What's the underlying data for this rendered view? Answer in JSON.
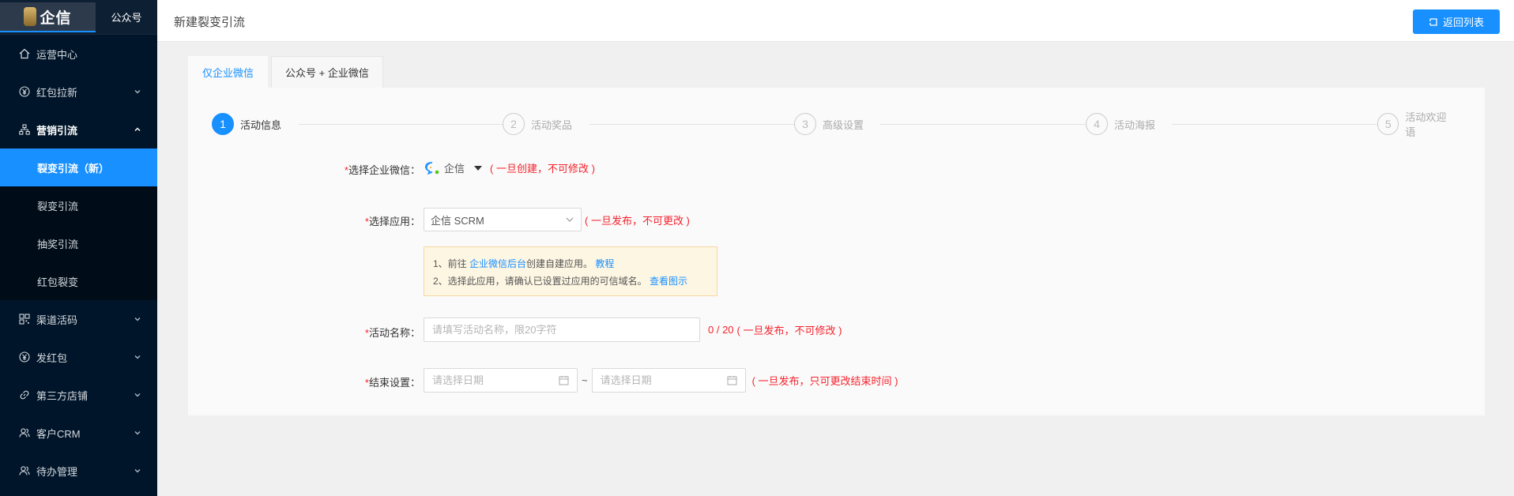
{
  "sidebar": {
    "logo_text": "企信",
    "account_tab": "公众号",
    "menu": [
      {
        "label": "运营中心",
        "icon": "home-icon"
      },
      {
        "label": "红包拉新",
        "icon": "yen-circle-icon"
      },
      {
        "label": "营销引流",
        "icon": "sitemap-icon"
      }
    ],
    "submenu": [
      {
        "label": "裂变引流（新）"
      },
      {
        "label": "裂变引流"
      },
      {
        "label": "抽奖引流"
      },
      {
        "label": "红包裂变"
      }
    ],
    "menu_after": [
      {
        "label": "渠道活码",
        "icon": "qrcode-icon"
      },
      {
        "label": "发红包",
        "icon": "yen-circle-icon"
      },
      {
        "label": "第三方店铺",
        "icon": "link-icon"
      },
      {
        "label": "客户CRM",
        "icon": "users-icon"
      },
      {
        "label": "待办管理",
        "icon": "users-icon"
      }
    ]
  },
  "header": {
    "title": "新建裂变引流",
    "back_label": "返回列表"
  },
  "tabs": [
    {
      "label": "仅企业微信",
      "active": true
    },
    {
      "label": "公众号 + 企业微信",
      "active": false
    }
  ],
  "steps": [
    {
      "num": "1",
      "label": "活动信息"
    },
    {
      "num": "2",
      "label": "活动奖品"
    },
    {
      "num": "3",
      "label": "高级设置"
    },
    {
      "num": "4",
      "label": "活动海报"
    },
    {
      "num": "5",
      "label": "活动欢迎语"
    }
  ],
  "form": {
    "corp_wechat": {
      "label": "选择企业微信：",
      "value": "企信",
      "hint": "( 一旦创建，不可修改 )"
    },
    "app": {
      "label": "选择应用：",
      "value": "企信 SCRM",
      "hint": "( 一旦发布，不可更改 )"
    },
    "notice": {
      "line1_prefix": "1、前往",
      "line1_link": "企业微信后台",
      "line1_suffix": "创建自建应用。",
      "line1_link2": "教程",
      "line2_text": "2、选择此应用，请确认已设置过应用的可信域名。",
      "line2_link": "查看图示"
    },
    "name": {
      "label": "活动名称：",
      "placeholder": "请填写活动名称，限20字符",
      "counter": "0 / 20",
      "hint": "( 一旦发布，不可修改 )"
    },
    "end": {
      "label": "结束设置：",
      "start_placeholder": "请选择日期",
      "separator": "~",
      "end_placeholder": "请选择日期",
      "hint": "( 一旦发布，只可更改结束时间 )"
    },
    "required_mark": "*"
  },
  "colors": {
    "primary": "#1890ff",
    "sidebar_bg": "#001529",
    "danger": "#f5222d"
  }
}
